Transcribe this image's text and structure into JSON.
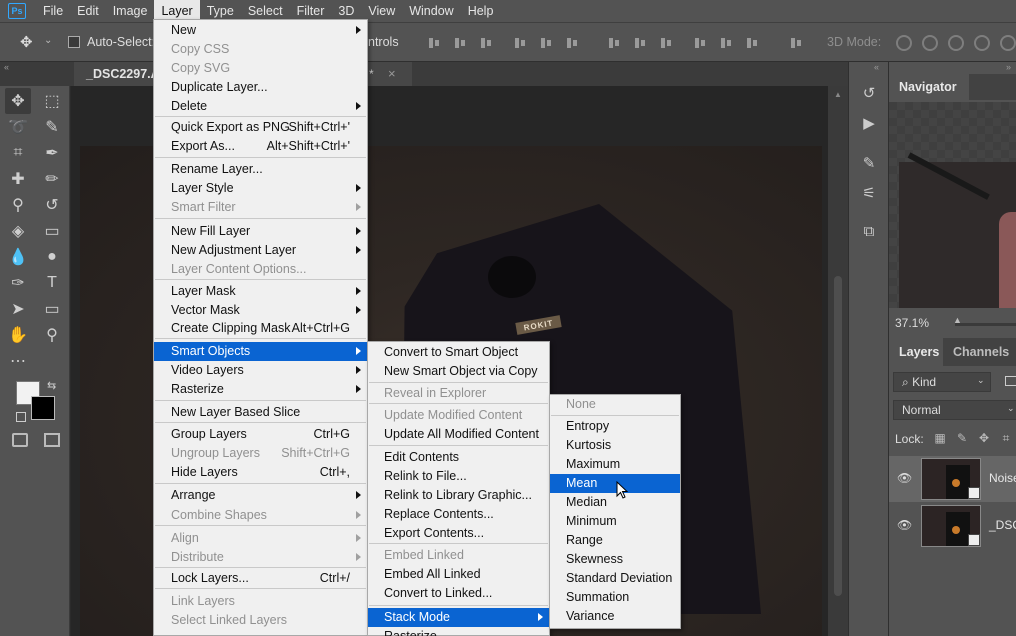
{
  "app": {
    "logo": "Ps"
  },
  "menubar": [
    "File",
    "Edit",
    "Image",
    "Layer",
    "Type",
    "Select",
    "Filter",
    "3D",
    "View",
    "Window",
    "Help"
  ],
  "options_bar": {
    "auto_select_label": "Auto-Select:",
    "controls_label": "ntrols",
    "mode_3d_label": "3D Mode:"
  },
  "document": {
    "tab_title": "_DSC2297.A",
    "tab_modified_marker": "*",
    "tab_close": "×",
    "badge_text": "ROKIT"
  },
  "panels": {
    "collapse_glyph": "«",
    "collapse_right_glyph": "»",
    "navigator": {
      "title": "Navigator",
      "zoom": "37.1%"
    },
    "layers": {
      "tab_layers": "Layers",
      "tab_channels": "Channels",
      "filter_kind": "Kind",
      "blend_mode": "Normal",
      "lock_label": "Lock:",
      "items": [
        {
          "name": "Noise"
        },
        {
          "name": "_DSC"
        }
      ]
    }
  },
  "layer_menu": [
    {
      "label": "New",
      "submenu": true
    },
    {
      "label": "Copy CSS",
      "disabled": true
    },
    {
      "label": "Copy SVG",
      "disabled": true
    },
    {
      "label": "Duplicate Layer..."
    },
    {
      "label": "Delete",
      "submenu": true
    },
    {
      "label": "Quick Export as PNG",
      "shortcut": "Shift+Ctrl+'"
    },
    {
      "label": "Export As...",
      "shortcut": "Alt+Shift+Ctrl+'"
    },
    {
      "label": "Rename Layer..."
    },
    {
      "label": "Layer Style",
      "submenu": true
    },
    {
      "label": "Smart Filter",
      "submenu": true,
      "disabled": true
    },
    {
      "label": "New Fill Layer",
      "submenu": true
    },
    {
      "label": "New Adjustment Layer",
      "submenu": true
    },
    {
      "label": "Layer Content Options...",
      "disabled": true
    },
    {
      "label": "Layer Mask",
      "submenu": true
    },
    {
      "label": "Vector Mask",
      "submenu": true
    },
    {
      "label": "Create Clipping Mask",
      "shortcut": "Alt+Ctrl+G"
    },
    {
      "label": "Smart Objects",
      "submenu": true,
      "highlight": true
    },
    {
      "label": "Video Layers",
      "submenu": true
    },
    {
      "label": "Rasterize",
      "submenu": true
    },
    {
      "label": "New Layer Based Slice"
    },
    {
      "label": "Group Layers",
      "shortcut": "Ctrl+G"
    },
    {
      "label": "Ungroup Layers",
      "shortcut": "Shift+Ctrl+G",
      "disabled": true
    },
    {
      "label": "Hide Layers",
      "shortcut": "Ctrl+,"
    },
    {
      "label": "Arrange",
      "submenu": true
    },
    {
      "label": "Combine Shapes",
      "submenu": true,
      "disabled": true
    },
    {
      "label": "Align",
      "submenu": true,
      "disabled": true
    },
    {
      "label": "Distribute",
      "submenu": true,
      "disabled": true
    },
    {
      "label": "Lock Layers...",
      "shortcut": "Ctrl+/"
    },
    {
      "label": "Link Layers",
      "disabled": true
    },
    {
      "label": "Select Linked Layers",
      "disabled": true
    }
  ],
  "smart_objects_menu": [
    {
      "label": "Convert to Smart Object"
    },
    {
      "label": "New Smart Object via Copy"
    },
    {
      "label": "Reveal in Explorer",
      "disabled": true
    },
    {
      "label": "Update Modified Content",
      "disabled": true
    },
    {
      "label": "Update All Modified Content"
    },
    {
      "label": "Edit Contents"
    },
    {
      "label": "Relink to File..."
    },
    {
      "label": "Relink to Library Graphic..."
    },
    {
      "label": "Replace Contents..."
    },
    {
      "label": "Export Contents..."
    },
    {
      "label": "Embed Linked",
      "disabled": true
    },
    {
      "label": "Embed All Linked"
    },
    {
      "label": "Convert to Linked..."
    },
    {
      "label": "Stack Mode",
      "submenu": true,
      "highlight": true
    },
    {
      "label": "Rasterize"
    }
  ],
  "stack_mode_menu": [
    {
      "label": "None",
      "disabled": true
    },
    {
      "label": "Entropy"
    },
    {
      "label": "Kurtosis"
    },
    {
      "label": "Maximum"
    },
    {
      "label": "Mean",
      "highlight": true
    },
    {
      "label": "Median"
    },
    {
      "label": "Minimum"
    },
    {
      "label": "Range"
    },
    {
      "label": "Skewness"
    },
    {
      "label": "Standard Deviation"
    },
    {
      "label": "Summation"
    },
    {
      "label": "Variance"
    }
  ]
}
